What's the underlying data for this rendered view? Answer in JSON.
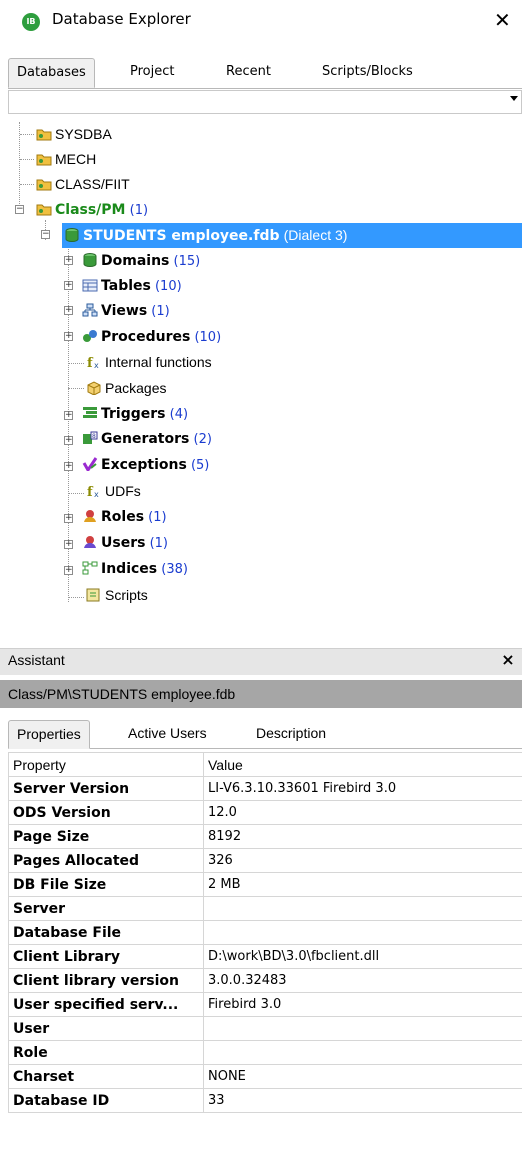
{
  "window": {
    "title": "Database Explorer",
    "logo_text": "IB",
    "close_glyph": "✕"
  },
  "tabs": [
    {
      "label": "Databases",
      "active": true
    },
    {
      "label": "Project",
      "active": false
    },
    {
      "label": "Recent",
      "active": false
    },
    {
      "label": "Scripts/Blocks",
      "active": false
    }
  ],
  "dropdown": {
    "value": ""
  },
  "tree": [
    {
      "label": "SYSDBA",
      "icon": "folder-key-icon",
      "count": ""
    },
    {
      "label": "MECH",
      "icon": "folder-key-icon",
      "count": ""
    },
    {
      "label": "CLASS/FIIT",
      "icon": "folder-key-icon",
      "count": ""
    },
    {
      "label": "Class/PM",
      "icon": "folder-key-icon",
      "count": "(1)"
    },
    {
      "label": "STUDENTS employee.fdb",
      "icon": "database-icon",
      "count": "(Dialect 3)"
    },
    {
      "label": "Domains",
      "icon": "domain-icon",
      "count": "(15)"
    },
    {
      "label": "Tables",
      "icon": "table-icon",
      "count": "(10)"
    },
    {
      "label": "Views",
      "icon": "view-icon",
      "count": "(1)"
    },
    {
      "label": "Procedures",
      "icon": "procedure-icon",
      "count": "(10)"
    },
    {
      "label": "Internal functions",
      "icon": "function-icon",
      "count": ""
    },
    {
      "label": "Packages",
      "icon": "package-icon",
      "count": ""
    },
    {
      "label": "Triggers",
      "icon": "trigger-icon",
      "count": "(4)"
    },
    {
      "label": "Generators",
      "icon": "generator-icon",
      "count": "(2)"
    },
    {
      "label": "Exceptions",
      "icon": "exception-icon",
      "count": "(5)"
    },
    {
      "label": "UDFs",
      "icon": "function-icon",
      "count": ""
    },
    {
      "label": "Roles",
      "icon": "role-icon",
      "count": "(1)"
    },
    {
      "label": "Users",
      "icon": "user-icon",
      "count": "(1)"
    },
    {
      "label": "Indices",
      "icon": "index-icon",
      "count": "(38)"
    },
    {
      "label": "Scripts",
      "icon": "script-icon",
      "count": ""
    }
  ],
  "assistant": {
    "title": "Assistant",
    "close_glyph": "×",
    "path": "Class/PM\\STUDENTS employee.fdb",
    "tabs": [
      {
        "label": "Properties",
        "active": true
      },
      {
        "label": "Active Users",
        "active": false
      },
      {
        "label": "Description",
        "active": false
      }
    ],
    "columns": [
      "Property",
      "Value"
    ],
    "rows": [
      {
        "key": "Server Version",
        "value": "LI-V6.3.10.33601 Firebird 3.0"
      },
      {
        "key": "ODS Version",
        "value": "12.0"
      },
      {
        "key": "Page Size",
        "value": "8192"
      },
      {
        "key": "Pages Allocated",
        "value": "326"
      },
      {
        "key": "DB File Size",
        "value": "2 MB"
      },
      {
        "key": "Server",
        "value": ""
      },
      {
        "key": "Database File",
        "value": ""
      },
      {
        "key": "Client Library",
        "value": "D:\\work\\BD\\3.0\\fbclient.dll"
      },
      {
        "key": "Client library version",
        "value": "3.0.0.32483"
      },
      {
        "key": "User specified serv...",
        "value": "Firebird 3.0"
      },
      {
        "key": "User",
        "value": ""
      },
      {
        "key": "Role",
        "value": ""
      },
      {
        "key": "Charset",
        "value": "NONE"
      },
      {
        "key": "Database ID",
        "value": "33"
      }
    ]
  },
  "colors": {
    "selection": "#3399ff",
    "count": "#1a3ccf",
    "folder": "#f0c040",
    "db": "#3a9a3a"
  }
}
